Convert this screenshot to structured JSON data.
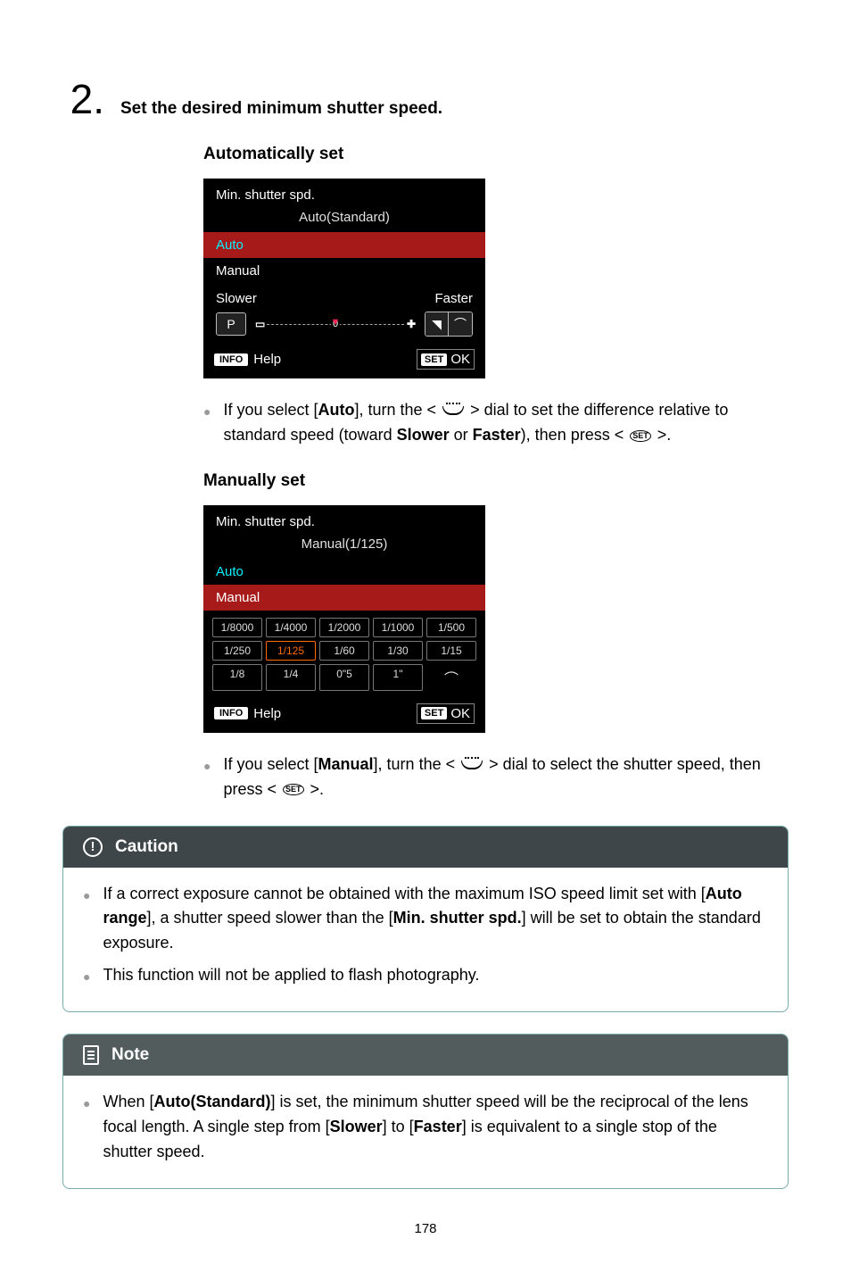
{
  "step": {
    "number": "2.",
    "title": "Set the desired minimum shutter speed."
  },
  "auto": {
    "heading": "Automatically set",
    "screen": {
      "title": "Min. shutter spd.",
      "breadcrumb": "Auto(Standard)",
      "opt_auto": "Auto",
      "opt_manual": "Manual",
      "slower": "Slower",
      "faster": "Faster",
      "info": "INFO",
      "help": "Help",
      "set": "SET",
      "ok": "OK"
    },
    "para_pre1": "If you select [",
    "para_auto": "Auto",
    "para_mid1": "], turn the < ",
    "para_mid2": " > dial to set the difference relative to standard speed (toward ",
    "para_slower": "Slower",
    "para_or": " or ",
    "para_faster": "Faster",
    "para_end1": "), then press < ",
    "para_end2": " >."
  },
  "manual": {
    "heading": "Manually set",
    "screen": {
      "title": "Min. shutter spd.",
      "breadcrumb": "Manual(1/125)",
      "opt_auto": "Auto",
      "opt_manual": "Manual",
      "speeds": [
        "1/8000",
        "1/4000",
        "1/2000",
        "1/1000",
        "1/500",
        "1/250",
        "1/125",
        "1/60",
        "1/30",
        "1/15",
        "1/8",
        "1/4",
        "0\"5",
        "1\"",
        ""
      ],
      "selected_index": 6,
      "info": "INFO",
      "help": "Help",
      "set": "SET",
      "ok": "OK"
    },
    "para_pre1": "If you select [",
    "para_manual": "Manual",
    "para_mid1": "], turn the < ",
    "para_mid2": " > dial to select the shutter speed, then press < ",
    "para_end": " >."
  },
  "caution": {
    "heading": "Caution",
    "i1_a": "If a correct exposure cannot be obtained with the maximum ISO speed limit set with [",
    "i1_b": "Auto range",
    "i1_c": "], a shutter speed slower than the [",
    "i1_d": "Min. shutter spd.",
    "i1_e": "] will be set to obtain the standard exposure.",
    "i2": "This function will not be applied to flash photography."
  },
  "note": {
    "heading": "Note",
    "n_a": "When [",
    "n_b": "Auto(Standard)",
    "n_c": "] is set, the minimum shutter speed will be the reciprocal of the lens focal length. A single step from [",
    "n_d": "Slower",
    "n_e": "] to [",
    "n_f": "Faster",
    "n_g": "] is equivalent to a single stop of the shutter speed."
  },
  "page_number": "178"
}
